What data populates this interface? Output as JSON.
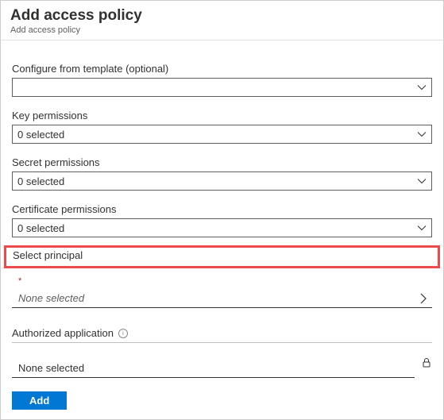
{
  "header": {
    "title": "Add access policy",
    "breadcrumb": "Add access policy"
  },
  "fields": {
    "template": {
      "label": "Configure from template (optional)",
      "value": ""
    },
    "keyPermissions": {
      "label": "Key permissions",
      "value": "0 selected"
    },
    "secretPermissions": {
      "label": "Secret permissions",
      "value": "0 selected"
    },
    "certificatePermissions": {
      "label": "Certificate permissions",
      "value": "0 selected"
    },
    "selectPrincipal": {
      "label": "Select principal",
      "required": "*",
      "value": "None selected"
    },
    "authorizedApplication": {
      "label": "Authorized application",
      "value": "None selected"
    }
  },
  "buttons": {
    "add": "Add"
  }
}
